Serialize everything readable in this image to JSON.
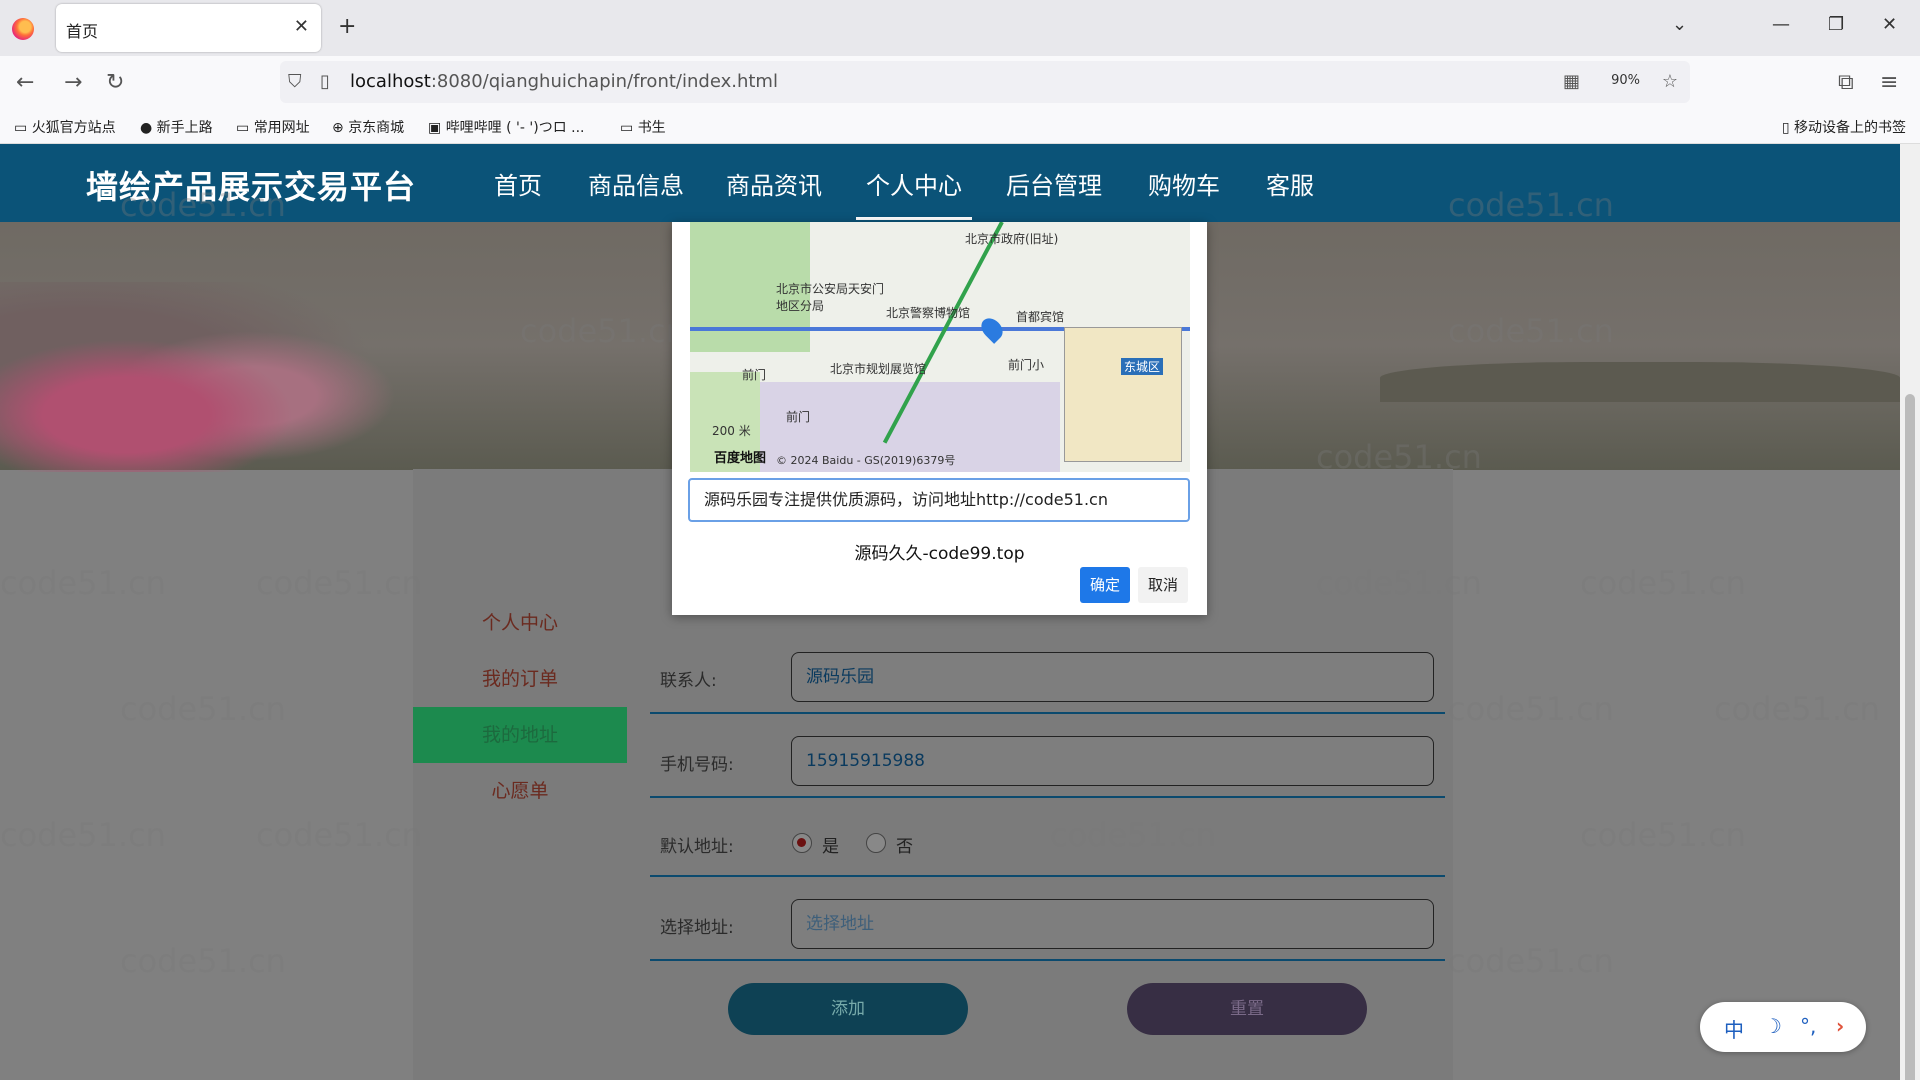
{
  "browser": {
    "tab_title": "首页",
    "url_host": "localhost",
    "url_rest": ":8080/qianghuichapin/front/index.html",
    "zoom": "90%",
    "bookmarks": [
      "火狐官方站点",
      "新手上路",
      "常用网址",
      "京东商城",
      "哔哩哔哩 ( '- ')つロ ...",
      "书生"
    ],
    "mobile_bookmarks": "移动设备上的书签"
  },
  "site": {
    "title": "墙绘产品展示交易平台",
    "nav": [
      "首页",
      "商品信息",
      "商品资讯",
      "个人中心",
      "后台管理",
      "购物车",
      "客服"
    ]
  },
  "sidebar": {
    "items": [
      "个人中心",
      "我的订单",
      "我的地址",
      "心愿单"
    ]
  },
  "form": {
    "contact_label": "联系人:",
    "contact_value": "源码乐园",
    "phone_label": "手机号码:",
    "phone_value": "15915915988",
    "default_label": "默认地址:",
    "radio_yes": "是",
    "radio_no": "否",
    "address_label": "选择地址:",
    "address_placeholder": "选择地址",
    "add_button": "添加",
    "reset_button": "重置"
  },
  "modal": {
    "map_labels": [
      "北京市政府(旧址)",
      "北京市公安局天安门地区分局",
      "北京警察博物馆",
      "首都宾馆",
      "北京市规划展览馆",
      "前门",
      "前门",
      "前门小",
      "东城区",
      "200 米"
    ],
    "map_credit": "百度地图",
    "map_copyright": "© 2024 Baidu - GS(2019)6379号",
    "input_value": "源码乐园专注提供优质源码，访问地址http://code51.cn",
    "caption": "源码久久-code99.top",
    "ok_button": "确定",
    "cancel_button": "取消"
  },
  "watermark": "code51.cn",
  "ime": [
    "中",
    "☽",
    "°,",
    "›"
  ]
}
